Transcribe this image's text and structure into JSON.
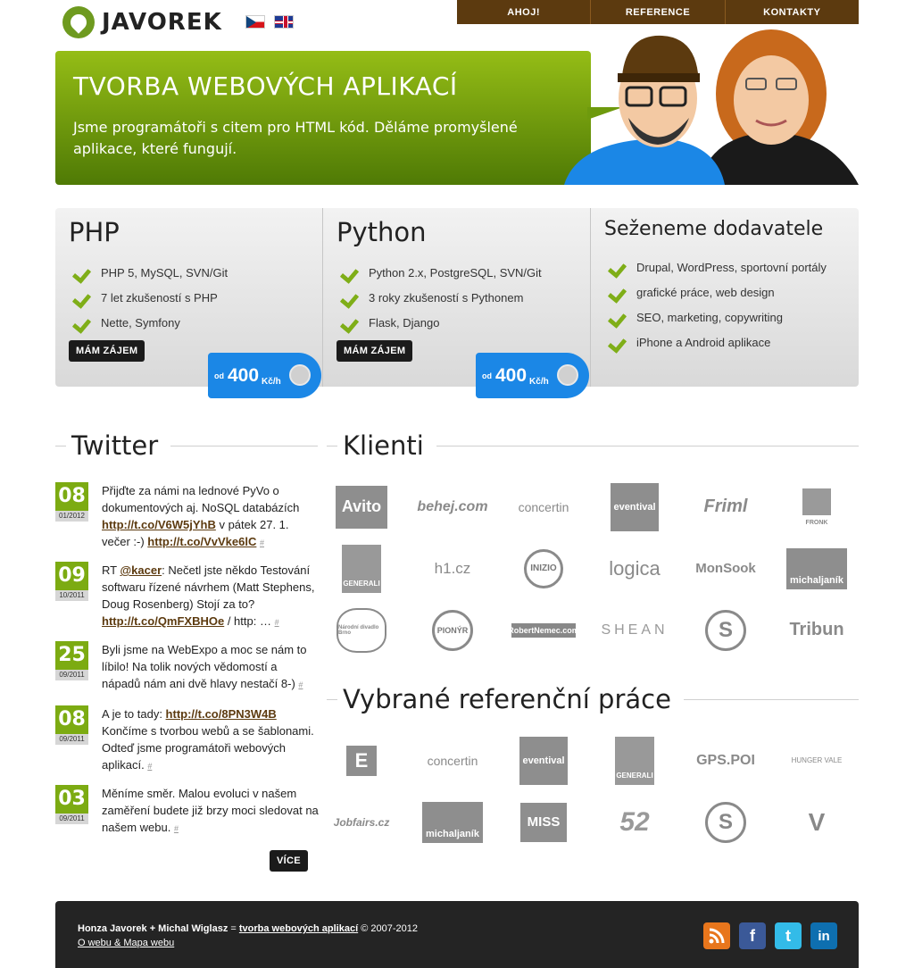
{
  "brand": {
    "name": "JAVOREK"
  },
  "nav": {
    "items": [
      "AHOJ!",
      "REFERENCE",
      "KONTAKTY"
    ]
  },
  "hero": {
    "title": "TVORBA WEBOVÝCH APLIKACÍ",
    "subtitle": "Jsme programátoři s citem pro HTML kód. Děláme promyšlené aplikace, které fungují."
  },
  "offers": [
    {
      "title": "PHP",
      "items": [
        "PHP 5, MySQL, SVN/Git",
        "7 let zkušeností s PHP",
        "Nette, Symfony"
      ],
      "button": "MÁM ZÁJEM",
      "price_prefix": "od",
      "price_value": "400",
      "price_unit": "Kč/h"
    },
    {
      "title": "Python",
      "items": [
        "Python 2.x, PostgreSQL, SVN/Git",
        "3 roky zkušeností s Pythonem",
        "Flask, Django"
      ],
      "button": "MÁM ZÁJEM",
      "price_prefix": "od",
      "price_value": "400",
      "price_unit": "Kč/h"
    },
    {
      "title": "Seženeme dodavatele",
      "items": [
        "Drupal, WordPress, sportovní portály",
        "grafické práce, web design",
        "SEO, marketing, copywriting",
        "iPhone a Android aplikace"
      ]
    }
  ],
  "twitter": {
    "heading": "Twitter",
    "tweets": [
      {
        "day": "08",
        "month_year": "01/2012"
      },
      {
        "day": "09",
        "month_year": "10/2011"
      },
      {
        "day": "25",
        "month_year": "09/2011"
      },
      {
        "day": "08",
        "month_year": "09/2011"
      },
      {
        "day": "03",
        "month_year": "09/2011"
      }
    ],
    "t1": {
      "a": "Přijďte za námi na lednové PyVo o dokumentových aj. NoSQL databázích ",
      "link1": "http://t.co/V6W5jYhB",
      "b": " v pátek 27. 1. večer :-) ",
      "link2": "http://t.co/VvVke6lC",
      "hash": "#"
    },
    "t2": {
      "a": "RT ",
      "mention": "@kacer",
      "b": ": Nečetl jste někdo Testování softwaru řízené návrhem (Matt Stephens, Doug Rosenberg) Stojí za to? ",
      "link1": "http://t.co/QmFXBHOe",
      "c": " / http: … ",
      "hash": "#"
    },
    "t3": {
      "a": "Byli jsme na WebExpo a moc se nám to líbilo! Na tolik nových vědomostí a nápadů nám ani dvě hlavy nestačí 8-) ",
      "hash": "#"
    },
    "t4": {
      "a": "A je to tady: ",
      "link1": "http://t.co/8PN3W4B",
      "b": " Končíme s tvorbou webů a se šablonami. Odteď jsme programátoři webových aplikací. ",
      "hash": "#"
    },
    "t5": {
      "a": "Měníme směr. Malou evoluci v našem zaměření budete již brzy moci sledovat na našem webu. ",
      "hash": "#"
    },
    "more_button": "VÍCE"
  },
  "clients": {
    "heading": "Klienti",
    "logos": [
      "Avito",
      "behej.com",
      "concertin",
      "eventival",
      "Friml",
      "FRONK",
      "GENERALI",
      "h1.cz",
      "INIZIO",
      "logica",
      "MonSook",
      "michaljaník",
      "Národní divadlo Brno",
      "PIONÝR",
      "RobertNemec.com",
      "SHEAN",
      "S",
      "Tribun"
    ]
  },
  "references": {
    "heading": "Vybrané referenční práce",
    "logos": [
      "E",
      "concertin",
      "eventival",
      "GENERALI",
      "GPS.POI",
      "HUNGER VALE",
      "Jobfairs.cz",
      "michaljaník",
      "MISS",
      "52",
      "S",
      "V"
    ]
  },
  "footer": {
    "authors": "Honza Javorek + Michal Wiglasz",
    "eq": " = ",
    "link": "tvorba webových aplikací",
    "copyright": " © 2007-2012",
    "about": "O webu & Mapa webu"
  },
  "social": [
    {
      "name": "rss",
      "color": "#e8761c"
    },
    {
      "name": "facebook",
      "color": "#3b5998"
    },
    {
      "name": "twitter",
      "color": "#33bbe8"
    },
    {
      "name": "linkedin",
      "color": "#0e6fb0"
    }
  ]
}
